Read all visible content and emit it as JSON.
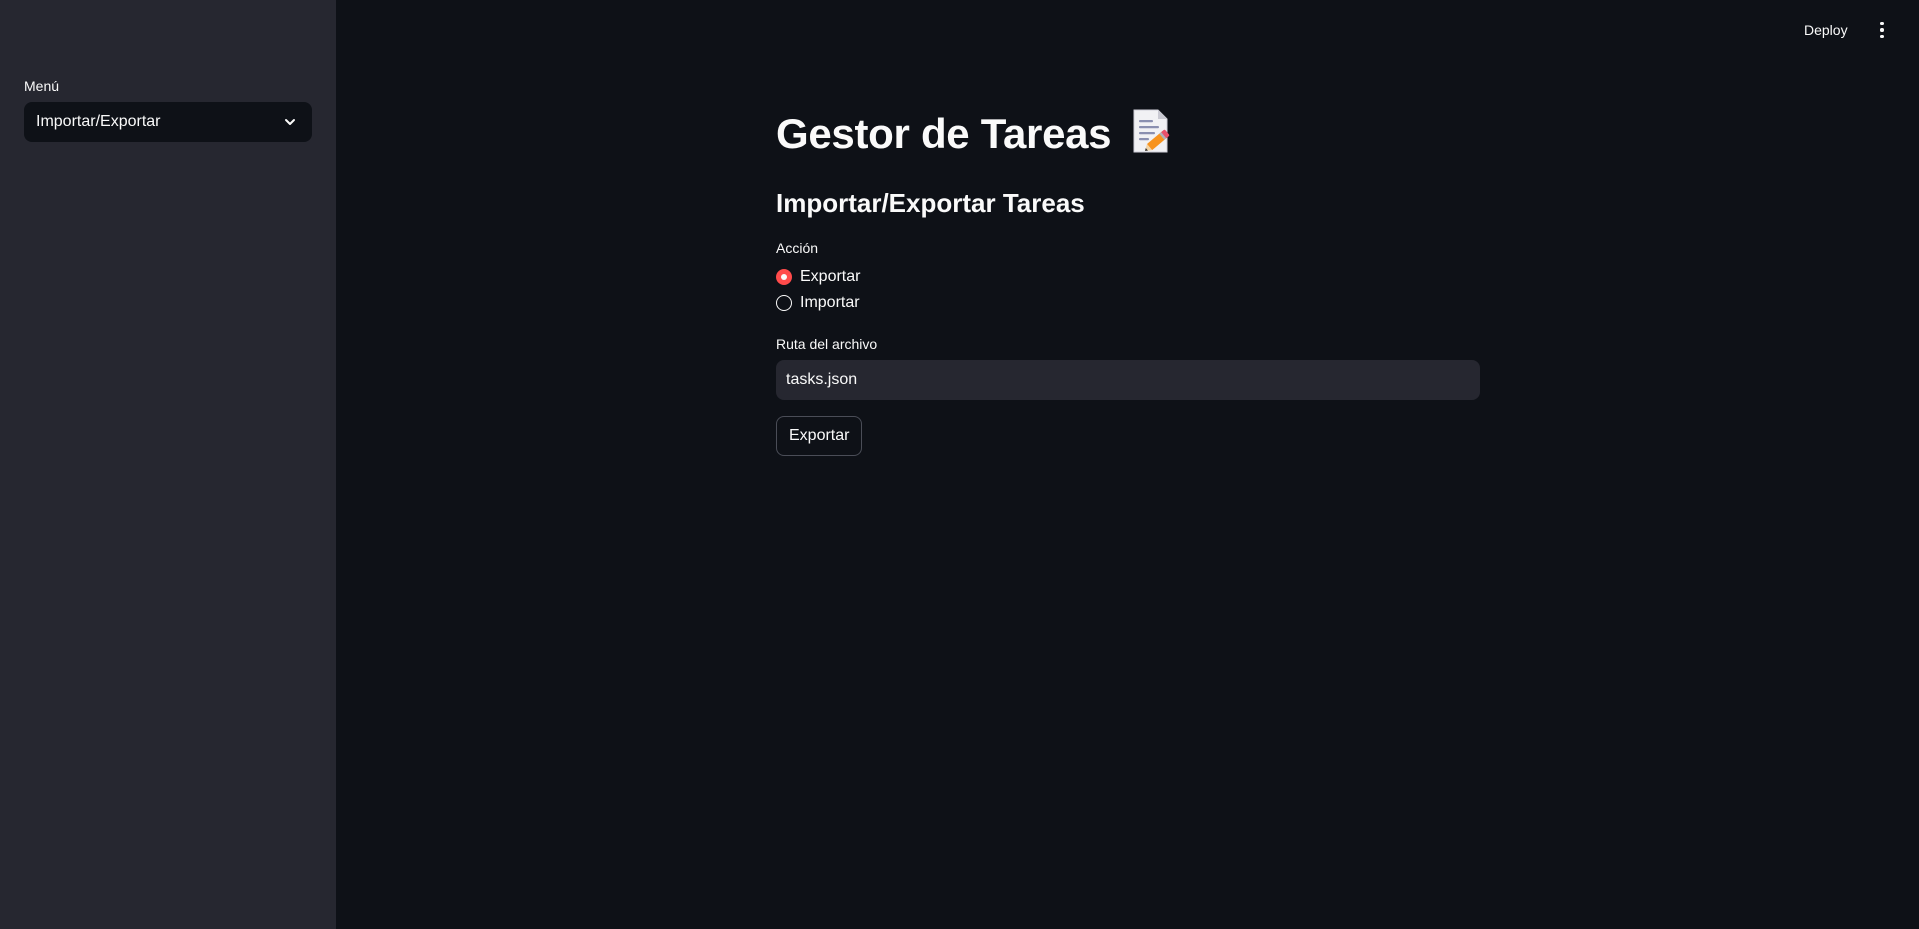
{
  "sidebar": {
    "menu_label": "Menú",
    "menu_selected": "Importar/Exportar"
  },
  "header": {
    "deploy_label": "Deploy",
    "more_icon": "kebab-menu-icon"
  },
  "main": {
    "title": "Gestor de Tareas",
    "title_icon": "memo-icon",
    "subtitle": "Importar/Exportar Tareas",
    "action": {
      "label": "Acción",
      "options": [
        {
          "label": "Exportar",
          "selected": true
        },
        {
          "label": "Importar",
          "selected": false
        }
      ]
    },
    "file_path": {
      "label": "Ruta del archivo",
      "value": "tasks.json"
    },
    "submit_label": "Exportar"
  },
  "colors": {
    "background": "#0e1117",
    "sidebar": "#262730",
    "accent": "#ff4b4b",
    "input_bg": "#262730",
    "text": "#fafafa"
  }
}
